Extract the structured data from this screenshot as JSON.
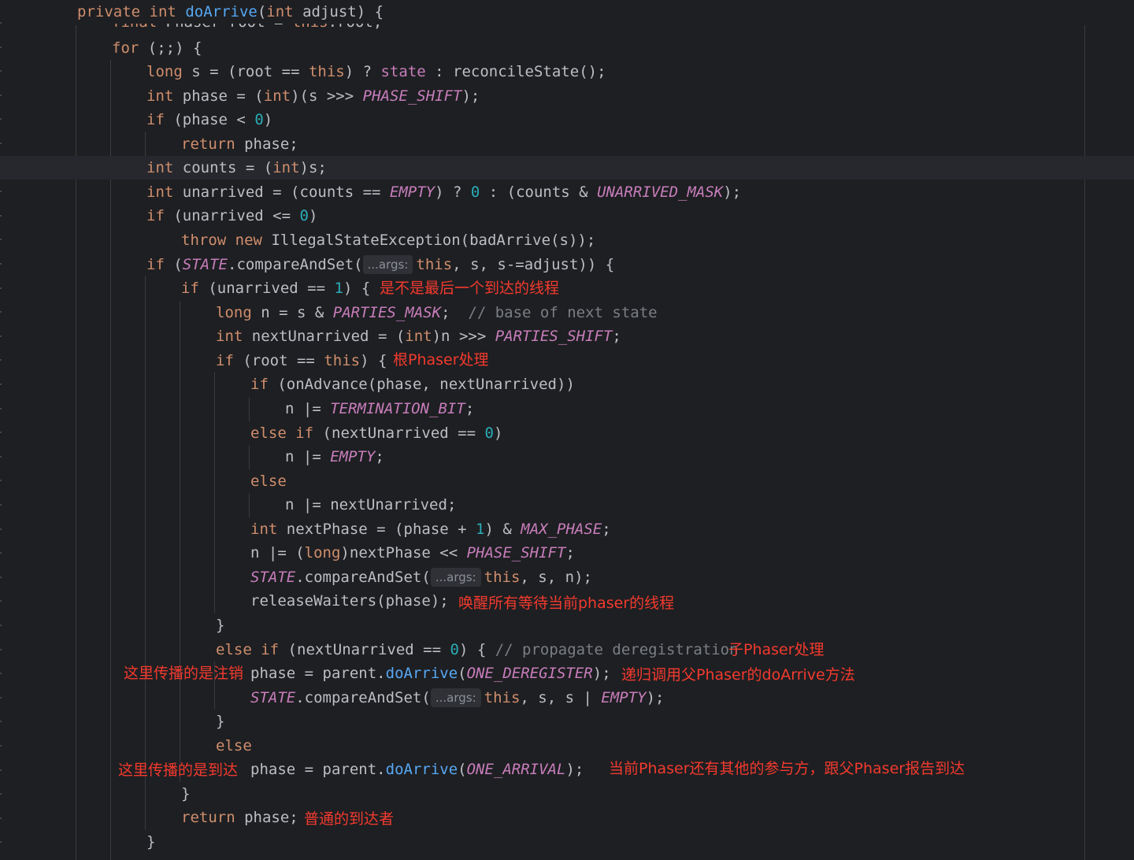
{
  "code_lines": [
    [
      "private int doArrive(int adjust) {"
    ],
    [
      "final Phaser root = this.root;"
    ],
    [
      "for (;;) {"
    ],
    [
      "long s = (root == this) ? state : reconcileState();"
    ],
    [
      "int phase = (int)(s >>> PHASE_SHIFT);"
    ],
    [
      "if (phase < 0)"
    ],
    [
      "return phase;"
    ],
    [
      "int counts = (int)s;"
    ],
    [
      "int unarrived = (counts == EMPTY) ? 0 : (counts & UNARRIVED_MASK);"
    ],
    [
      "if (unarrived <= 0)"
    ],
    [
      "throw new IllegalStateException(badArrive(s));"
    ],
    [
      "if (STATE.compareAndSet(",
      "...args:",
      "this, s, s-=adjust)) {"
    ],
    [
      "if (unarrived == 1) {"
    ],
    [
      "long n = s & PARTIES_MASK;  // base of next state"
    ],
    [
      "int nextUnarrived = (int)n >>> PARTIES_SHIFT;"
    ],
    [
      "if (root == this) {"
    ],
    [
      "if (onAdvance(phase, nextUnarrived))"
    ],
    [
      "n |= TERMINATION_BIT;"
    ],
    [
      "else if (nextUnarrived == 0)"
    ],
    [
      "n |= EMPTY;"
    ],
    [
      "else"
    ],
    [
      "n |= nextUnarrived;"
    ],
    [
      "int nextPhase = (phase + 1) & MAX_PHASE;"
    ],
    [
      "n |= (long)nextPhase << PHASE_SHIFT;"
    ],
    [
      "STATE.compareAndSet(",
      "...args:",
      "this, s, n);"
    ],
    [
      "releaseWaiters(phase);"
    ],
    [
      "}"
    ],
    [
      "else if (nextUnarrived == 0) { // propagate deregistration"
    ],
    [
      "phase = parent.doArrive(ONE_DEREGISTER);"
    ],
    [
      "STATE.compareAndSet(",
      "...args:",
      "this, s, s | EMPTY);"
    ],
    [
      "}"
    ],
    [
      "else"
    ],
    [
      "phase = parent.doArrive(ONE_ARRIVAL);"
    ],
    [
      "}"
    ],
    [
      "return phase;"
    ],
    [
      "}"
    ]
  ],
  "annotations": {
    "last_arriver": "是不是最后一个到达的线程",
    "root_phaser": "根Phaser处理",
    "wake_waiters": "唤醒所有等待当前phaser的线程",
    "child_phaser": "子Phaser处理",
    "propagate_dereg": "这里传播的是注销",
    "recursive_call": "递归调用父Phaser的doArrive方法",
    "propagate_arrival": "这里传播的是到达",
    "report_parent": "当前Phaser还有其他的参与方，跟父Phaser报告到达",
    "normal_arriver": "普通的到达者"
  },
  "colors": {
    "background": "#1e1f22",
    "keyword": "#cf8e6d",
    "function": "#56a8f5",
    "number": "#2aacb8",
    "constant": "#c77dbb",
    "comment": "#7a7e85",
    "annotation": "#f23a2e"
  }
}
